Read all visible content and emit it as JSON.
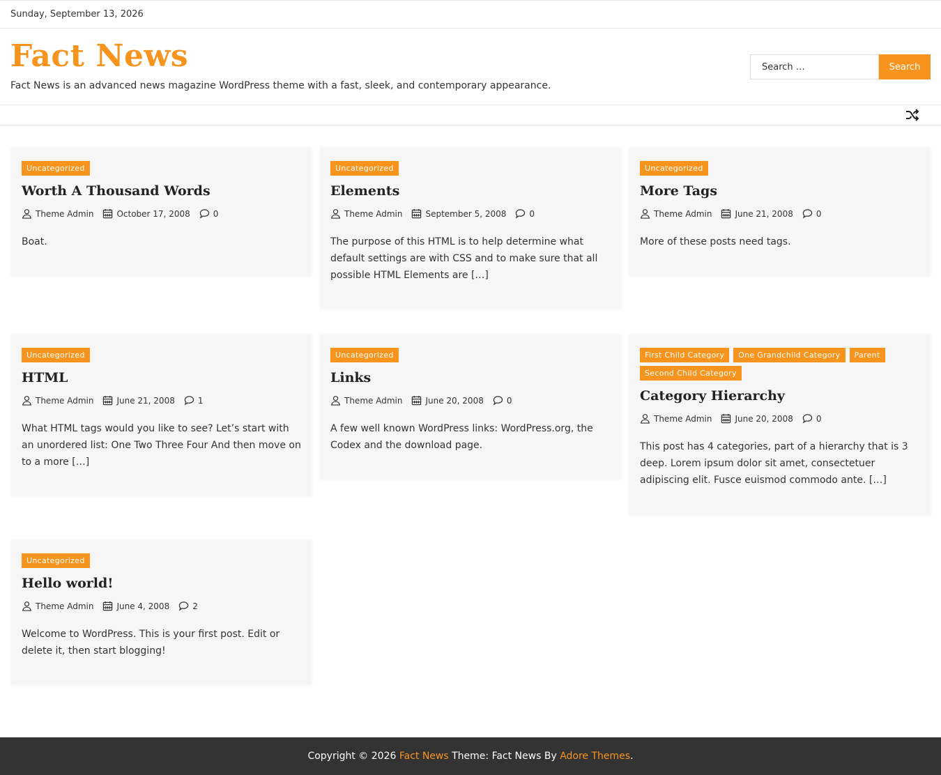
{
  "topbar": {
    "date": "Sunday, September 13, 2026"
  },
  "header": {
    "site_title": "Fact News",
    "tagline": "Fact News is an advanced news magazine WordPress theme with a fast, sleek, and contemporary appearance.",
    "search_placeholder": "Search …",
    "search_button": "Search",
    "shuffle_icon": "shuffle-icon"
  },
  "colors": {
    "accent": "#f7941d",
    "card_bg": "#f6f6f6",
    "footer_bg": "#333333"
  },
  "posts": [
    {
      "categories": [
        "Uncategorized"
      ],
      "title": "Worth A Thousand Words",
      "author": "Theme Admin",
      "date": "October 17, 2008",
      "comments": "0",
      "excerpt": "Boat."
    },
    {
      "categories": [
        "Uncategorized"
      ],
      "title": "Elements",
      "author": "Theme Admin",
      "date": "September 5, 2008",
      "comments": "0",
      "excerpt": "The purpose of this HTML is to help determine what default settings are with CSS and to make sure that all possible HTML Elements are […]"
    },
    {
      "categories": [
        "Uncategorized"
      ],
      "title": "More Tags",
      "author": "Theme Admin",
      "date": "June 21, 2008",
      "comments": "0",
      "excerpt": "More of these posts need tags."
    },
    {
      "categories": [
        "Uncategorized"
      ],
      "title": "HTML",
      "author": "Theme Admin",
      "date": "June 21, 2008",
      "comments": "1",
      "excerpt": "What HTML tags would you like to see? Let’s start with an unordered list: One Two Three Four And then move on to a more […]"
    },
    {
      "categories": [
        "Uncategorized"
      ],
      "title": "Links",
      "author": "Theme Admin",
      "date": "June 20, 2008",
      "comments": "0",
      "excerpt": "A few well known WordPress links: WordPress.org, the Codex and the download page."
    },
    {
      "categories": [
        "First Child Category",
        "One Grandchild Category",
        "Parent",
        "Second Child Category"
      ],
      "title": "Category Hierarchy",
      "author": "Theme Admin",
      "date": "June 20, 2008",
      "comments": "0",
      "excerpt": "This post has 4 categories, part of a hierarchy that is 3 deep. Lorem ipsum dolor sit amet, consectetuer adipiscing elit. Fusce euismod commodo ante. […]"
    },
    {
      "categories": [
        "Uncategorized"
      ],
      "title": "Hello world!",
      "author": "Theme Admin",
      "date": "June 4, 2008",
      "comments": "2",
      "excerpt": "Welcome to WordPress. This is your first post. Edit or delete it, then start blogging!"
    }
  ],
  "footer": {
    "copyright": "Copyright © 2026 ",
    "site_link": "Fact News",
    "theme_text": " Theme: Fact News By ",
    "theme_author": "Adore Themes",
    "period": "."
  }
}
